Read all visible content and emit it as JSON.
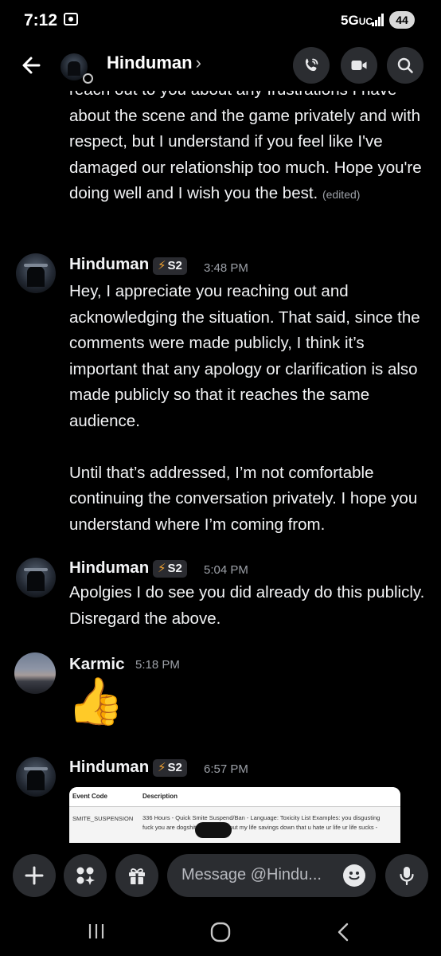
{
  "status_bar": {
    "time": "7:12",
    "network": "5G",
    "network_sub": "UC",
    "battery": "44"
  },
  "header": {
    "name": "Hinduman",
    "chevron": "›"
  },
  "messages": {
    "continued": {
      "text": "reach out to you about any frustrations I have about the scene and the game privately and with respect, but I understand if you feel like I've damaged our relationship too much. Hope you're doing well and I wish you the best.",
      "edited": "(edited)"
    },
    "m1": {
      "author": "Hinduman",
      "badge": "S2",
      "time": "3:48 PM",
      "para1": "Hey, I appreciate you reaching out and acknowledging the situation. That said, since the comments were made publicly, I think it’s important that any apology or clarification is also made publicly so that it reaches the same audience.",
      "para2": "Until that’s addressed, I’m not comfortable continuing the conversation privately. I hope you understand where I’m coming from."
    },
    "m2": {
      "author": "Hinduman",
      "badge": "S2",
      "time": "5:04 PM",
      "text": "Apolgies I do see you did already do this publicly. Disregard the above."
    },
    "m3": {
      "author": "Karmic",
      "time": "5:18 PM",
      "emoji": "👍"
    },
    "m4": {
      "author": "Hinduman",
      "badge": "S2",
      "time": "6:57 PM",
      "attachment": {
        "col1_header": "Event Code",
        "col2_header": "Description",
        "code": "SMITE_SUSPENSION",
        "description": "336 Hours - Quick Smite Suspend/Ban - Language: Toxicity List Examples: you disgusting fuck you are dogshit and i would put my life savings down that u hate ur life ur life sucks -"
      }
    }
  },
  "composer": {
    "placeholder": "Message @Hindu..."
  },
  "colors": {
    "background": "#000000",
    "surface": "#2b2d31",
    "text": "#f2f3f5",
    "muted": "#9ca0a7",
    "bolt": "#f0a232"
  }
}
